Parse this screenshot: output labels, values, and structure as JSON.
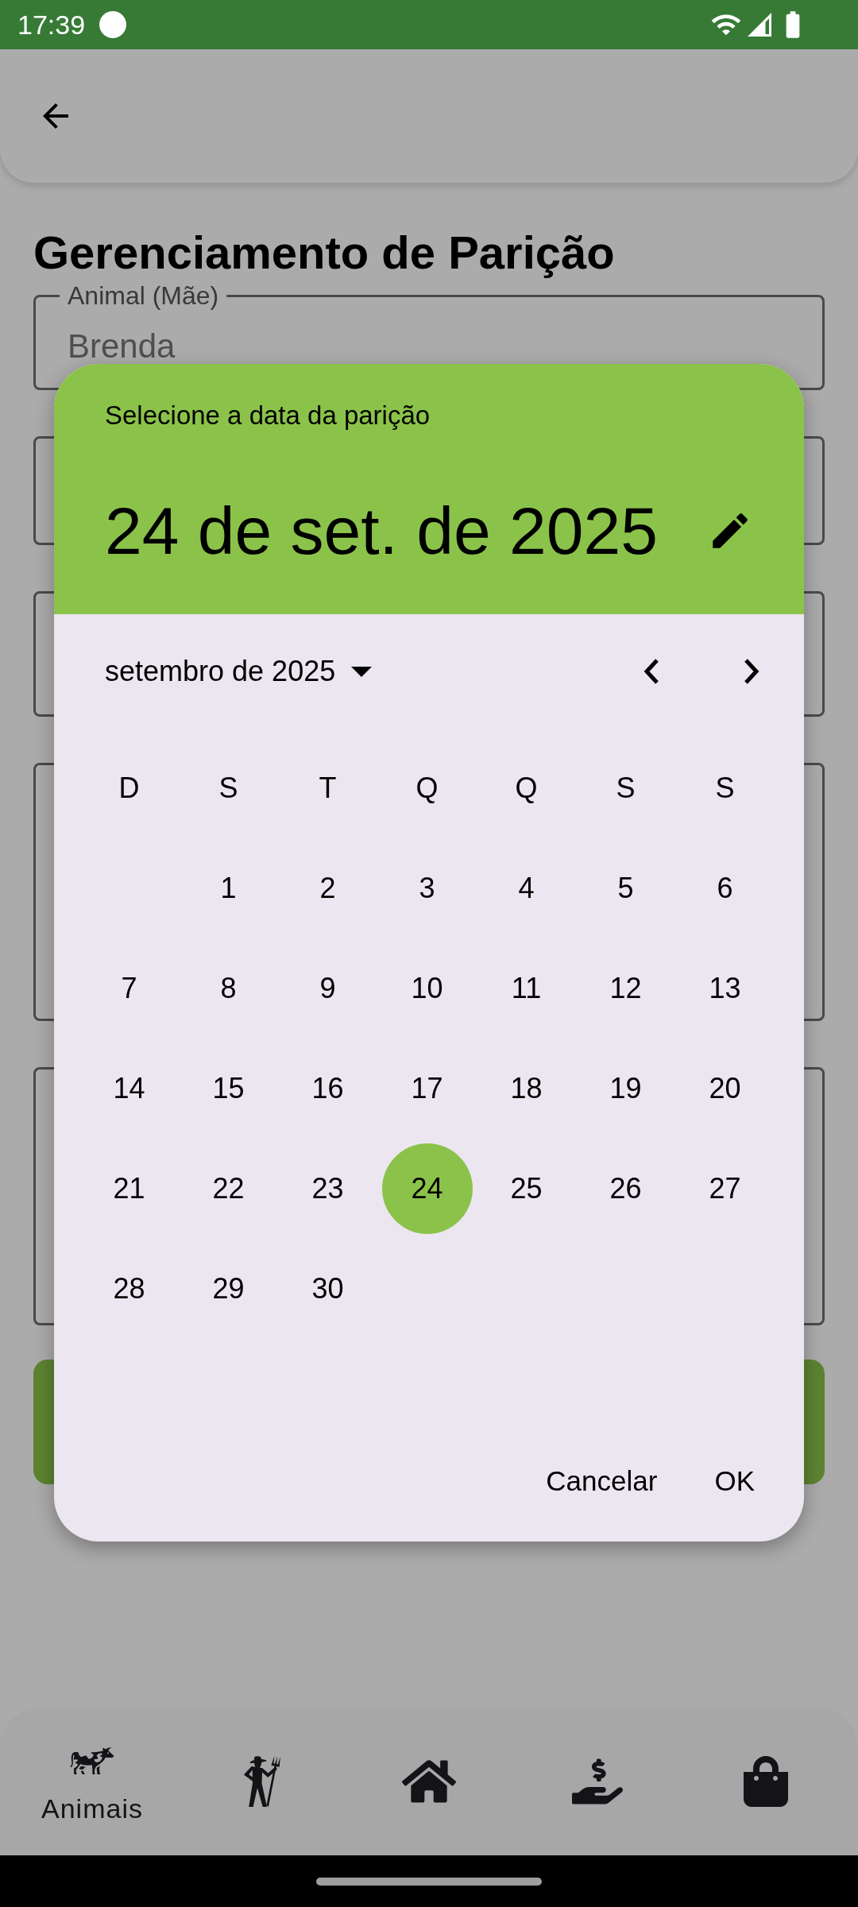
{
  "status_bar": {
    "time": "17:39"
  },
  "title": "Gerenciamento de Parição",
  "fields": [
    {
      "kind": "filled",
      "label": "Animal (Mãe)",
      "value": "Brenda"
    },
    {
      "kind": "short"
    },
    {
      "kind": "medium"
    },
    {
      "kind": "tall"
    },
    {
      "kind": "tall"
    }
  ],
  "date_picker": {
    "heading": "Selecione a data da parição",
    "selected_date": "24 de set. de 2025",
    "month_label": "setembro de 2025",
    "weekdays": [
      "D",
      "S",
      "T",
      "Q",
      "Q",
      "S",
      "S"
    ],
    "weeks": [
      [
        {
          "label": "1",
          "selected": false
        },
        {
          "label": "2",
          "selected": false
        },
        {
          "label": "3",
          "selected": false
        },
        {
          "label": "4",
          "selected": false
        },
        {
          "label": "5",
          "selected": false
        },
        {
          "label": "6",
          "selected": false
        }
      ],
      [
        {
          "label": "7",
          "selected": false
        },
        {
          "label": "8",
          "selected": false
        },
        {
          "label": "9",
          "selected": false
        },
        {
          "label": "10",
          "selected": false
        },
        {
          "label": "11",
          "selected": false
        },
        {
          "label": "12",
          "selected": false
        },
        {
          "label": "13",
          "selected": false
        }
      ],
      [
        {
          "label": "14",
          "selected": false
        },
        {
          "label": "15",
          "selected": false
        },
        {
          "label": "16",
          "selected": false
        },
        {
          "label": "17",
          "selected": false
        },
        {
          "label": "18",
          "selected": false
        },
        {
          "label": "19",
          "selected": false
        },
        {
          "label": "20",
          "selected": false
        }
      ],
      [
        {
          "label": "21",
          "selected": false
        },
        {
          "label": "22",
          "selected": false
        },
        {
          "label": "23",
          "selected": false
        },
        {
          "label": "24",
          "selected": true
        },
        {
          "label": "25",
          "selected": false
        },
        {
          "label": "26",
          "selected": false
        },
        {
          "label": "27",
          "selected": false
        }
      ],
      [
        {
          "label": "28",
          "selected": false
        },
        {
          "label": "29",
          "selected": false
        },
        {
          "label": "30",
          "selected": false
        }
      ]
    ],
    "buttons": [
      "Cancelar",
      "OK"
    ]
  },
  "bottom_nav": [
    {
      "kind": "cow",
      "label": "Animais",
      "selected": true
    },
    {
      "kind": "farmer",
      "selected": false
    },
    {
      "kind": "home",
      "selected": false
    },
    {
      "kind": "income",
      "selected": false
    },
    {
      "kind": "shop",
      "selected": false
    }
  ]
}
